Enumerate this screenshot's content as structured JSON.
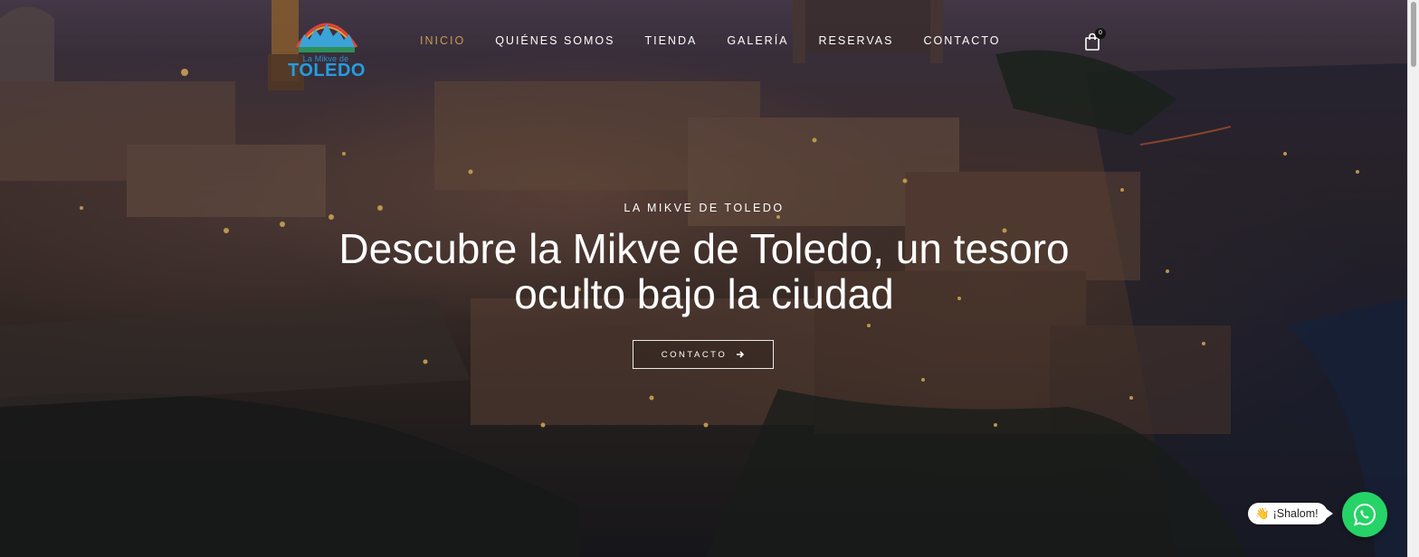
{
  "brand": {
    "logo_line1": "La Mikve de",
    "logo_line2": "TOLEDO"
  },
  "nav": {
    "items": [
      {
        "label": "INICIO",
        "active": true
      },
      {
        "label": "QUIÉNES SOMOS",
        "active": false
      },
      {
        "label": "TIENDA",
        "active": false
      },
      {
        "label": "GALERÍA",
        "active": false
      },
      {
        "label": "RESERVAS",
        "active": false
      },
      {
        "label": "CONTACTO",
        "active": false
      }
    ]
  },
  "cart": {
    "count": "0",
    "icon": "shopping-bag-icon"
  },
  "hero": {
    "eyebrow": "LA MIKVE DE TOLEDO",
    "headline": "Descubre la Mikve de Toledo, un tesoro oculto bajo la ciudad",
    "cta_label": "CONTACTO",
    "cta_icon": "arrow-right-icon"
  },
  "whatsapp": {
    "bubble_emoji": "👋",
    "bubble_text": "¡Shalom!",
    "icon": "whatsapp-icon"
  },
  "colors": {
    "nav_active": "#c79b56",
    "whatsapp": "#25d366",
    "logo_blue": "#2a9bdc"
  }
}
